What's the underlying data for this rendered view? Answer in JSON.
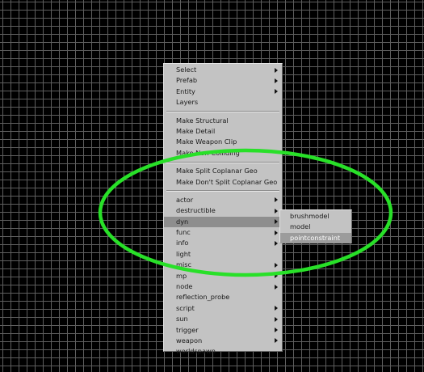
{
  "menu": {
    "groups": [
      [
        {
          "label": "Select",
          "submenu": true
        },
        {
          "label": "Prefab",
          "submenu": true
        },
        {
          "label": "Entity",
          "submenu": true
        },
        {
          "label": "Layers",
          "submenu": false
        }
      ],
      [
        {
          "label": "Make Structural",
          "submenu": false
        },
        {
          "label": "Make Detail",
          "submenu": false
        },
        {
          "label": "Make Weapon Clip",
          "submenu": false
        },
        {
          "label": "Make Non-Colliding",
          "submenu": false
        }
      ],
      [
        {
          "label": "Make Split Coplanar Geo",
          "submenu": false
        },
        {
          "label": "Make Don't Split Coplanar Geo",
          "submenu": false
        }
      ],
      [
        {
          "label": "actor",
          "submenu": true
        },
        {
          "label": "destructible",
          "submenu": true
        },
        {
          "label": "dyn",
          "submenu": true,
          "active": true
        },
        {
          "label": "func",
          "submenu": true
        },
        {
          "label": "info",
          "submenu": true
        },
        {
          "label": "light",
          "submenu": false
        },
        {
          "label": "misc",
          "submenu": true
        },
        {
          "label": "mp",
          "submenu": true
        },
        {
          "label": "node",
          "submenu": true
        },
        {
          "label": "reflection_probe",
          "submenu": false
        },
        {
          "label": "script",
          "submenu": true
        },
        {
          "label": "sun",
          "submenu": true
        },
        {
          "label": "trigger",
          "submenu": true
        },
        {
          "label": "weapon",
          "submenu": true
        },
        {
          "label": "worldspawn",
          "submenu": false
        }
      ]
    ]
  },
  "submenu": {
    "items": [
      {
        "label": "brushmodel",
        "hilite": false
      },
      {
        "label": "model",
        "hilite": false
      },
      {
        "label": "pointconstraint",
        "hilite": true
      }
    ]
  },
  "colors": {
    "grid_line": "#5e5e5e",
    "menu_bg": "#c3c3c3",
    "highlight_ellipse": "#28e028"
  }
}
